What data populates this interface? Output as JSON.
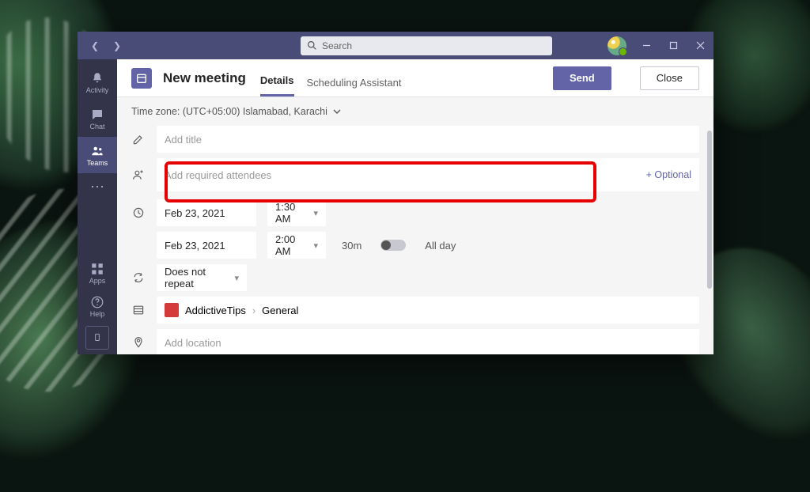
{
  "titlebar": {
    "search_placeholder": "Search"
  },
  "rail": {
    "activity": "Activity",
    "chat": "Chat",
    "teams": "Teams",
    "apps": "Apps",
    "help": "Help"
  },
  "header": {
    "title": "New meeting",
    "tab_details": "Details",
    "tab_scheduling": "Scheduling Assistant",
    "send": "Send",
    "close": "Close"
  },
  "timezone": {
    "label": "Time zone: (UTC+05:00) Islamabad, Karachi"
  },
  "form": {
    "title_placeholder": "Add title",
    "attendees_placeholder": "Add required attendees",
    "optional_link": "+ Optional",
    "start_date": "Feb 23, 2021",
    "start_time": "1:30 AM",
    "end_date": "Feb 23, 2021",
    "end_time": "2:00 AM",
    "duration": "30m",
    "all_day": "All day",
    "repeat": "Does not repeat",
    "channel_team": "AddictiveTips",
    "channel_name": "General",
    "location_placeholder": "Add location"
  }
}
